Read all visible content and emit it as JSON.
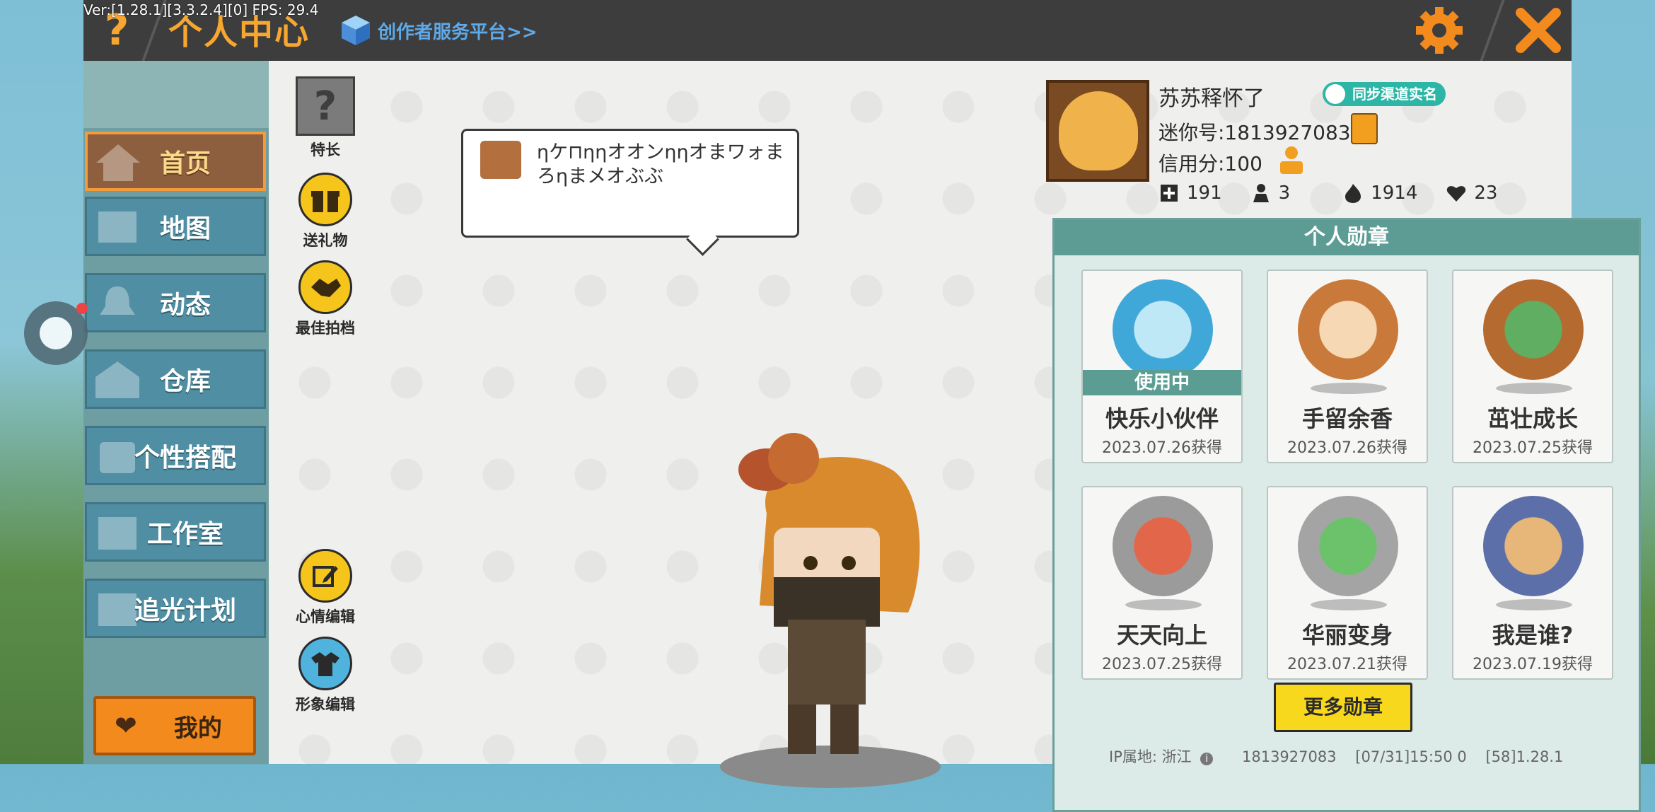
{
  "debug": "Ver:[1.28.1][3.3.2.4][0] FPS: 29.4",
  "titlebar": {
    "help": "?",
    "title": "个人中心",
    "creator_link": "创作者服务平台>>"
  },
  "sidebar": {
    "items": [
      {
        "label": "首页",
        "icon": "house-icon",
        "active": true
      },
      {
        "label": "地图",
        "icon": "map-icon",
        "active": false
      },
      {
        "label": "动态",
        "icon": "bell-icon",
        "active": false
      },
      {
        "label": "仓库",
        "icon": "warehouse-icon",
        "active": false
      },
      {
        "label": "个性搭配",
        "icon": "outfit-icon",
        "active": false
      },
      {
        "label": "工作室",
        "icon": "studio-icon",
        "active": false
      },
      {
        "label": "追光计划",
        "icon": "spotlight-icon",
        "active": false
      }
    ],
    "mine": {
      "label": "我的",
      "icon": "heart-icon"
    }
  },
  "actions": {
    "trait": {
      "label": "特长",
      "icon": "question-box-icon"
    },
    "gift": {
      "label": "送礼物",
      "icon": "gift-icon"
    },
    "partner": {
      "label": "最佳拍档",
      "icon": "handshake-icon"
    },
    "mood": {
      "label": "心情编辑",
      "icon": "edit-icon"
    },
    "appearance": {
      "label": "形象编辑",
      "icon": "outfit-icon"
    }
  },
  "bubble": {
    "text": "ηケ⊓ηηオオンηηオまワォまろηまメオぶぶ"
  },
  "profile": {
    "username": "苏苏释怀了",
    "sync_badge": "同步渠道实名",
    "mini_id": "迷你号:1813927083",
    "credit": "信用分:100",
    "stats": [
      {
        "icon": "add-friend-icon",
        "value": "191"
      },
      {
        "icon": "fans-icon",
        "value": "3"
      },
      {
        "icon": "fire-icon",
        "value": "1914"
      },
      {
        "icon": "like-heart-icon",
        "value": "23"
      }
    ]
  },
  "badges": {
    "header": "个人勋章",
    "in_use_label": "使用中",
    "items": [
      {
        "name": "快乐小伙伴",
        "date": "2023.07.26获得",
        "in_use": true,
        "color": "#3fa8d8"
      },
      {
        "name": "手留余香",
        "date": "2023.07.26获得",
        "in_use": false,
        "color": "#c9793a"
      },
      {
        "name": "茁壮成长",
        "date": "2023.07.25获得",
        "in_use": false,
        "color": "#b56a2f"
      },
      {
        "name": "天天向上",
        "date": "2023.07.25获得",
        "in_use": false,
        "color": "#9b9b9b"
      },
      {
        "name": "华丽变身",
        "date": "2023.07.21获得",
        "in_use": false,
        "color": "#a4a4a4"
      },
      {
        "name": "我是谁?",
        "date": "2023.07.19获得",
        "in_use": false,
        "color": "#5d6fa8"
      }
    ],
    "more": "更多勋章"
  },
  "footer": {
    "ip": "IP属地: 浙江",
    "id": "1813927083",
    "time": "[07/31]15:50 0",
    "version": "[58]1.28.1"
  }
}
